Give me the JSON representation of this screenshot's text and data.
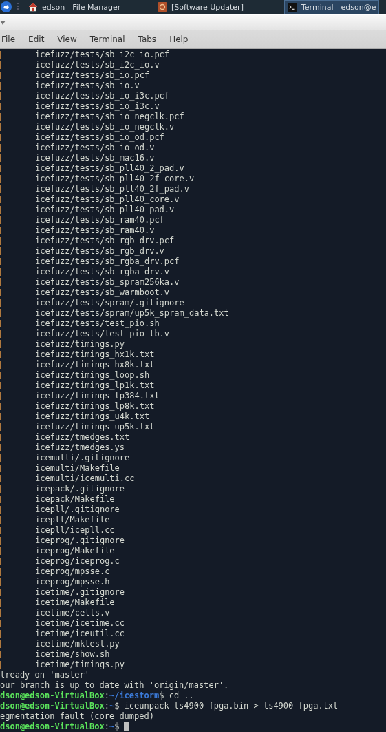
{
  "taskbar": {
    "items": [
      {
        "kind": "home",
        "label": "edson - File Manager",
        "selected": false
      },
      {
        "kind": "updater",
        "label": "[Software Updater]",
        "selected": false
      },
      {
        "kind": "terminal",
        "label": "Terminal - edson@e",
        "selected": true
      }
    ]
  },
  "menu": [
    "File",
    "Edit",
    "View",
    "Terminal",
    "Tabs",
    "Help"
  ],
  "terminal": {
    "lines": [
      {
        "kind": "file",
        "text": "icefuzz/tests/sb_i2c_io.pcf"
      },
      {
        "kind": "file",
        "text": "icefuzz/tests/sb_i2c_io.v"
      },
      {
        "kind": "file",
        "text": "icefuzz/tests/sb_io.pcf"
      },
      {
        "kind": "file",
        "text": "icefuzz/tests/sb_io.v"
      },
      {
        "kind": "file",
        "text": "icefuzz/tests/sb_io_i3c.pcf"
      },
      {
        "kind": "file",
        "text": "icefuzz/tests/sb_io_i3c.v"
      },
      {
        "kind": "file",
        "text": "icefuzz/tests/sb_io_negclk.pcf"
      },
      {
        "kind": "file",
        "text": "icefuzz/tests/sb_io_negclk.v"
      },
      {
        "kind": "file",
        "text": "icefuzz/tests/sb_io_od.pcf"
      },
      {
        "kind": "file",
        "text": "icefuzz/tests/sb_io_od.v"
      },
      {
        "kind": "file",
        "text": "icefuzz/tests/sb_mac16.v"
      },
      {
        "kind": "file",
        "text": "icefuzz/tests/sb_pll40_2_pad.v"
      },
      {
        "kind": "file",
        "text": "icefuzz/tests/sb_pll40_2f_core.v"
      },
      {
        "kind": "file",
        "text": "icefuzz/tests/sb_pll40_2f_pad.v"
      },
      {
        "kind": "file",
        "text": "icefuzz/tests/sb_pll40_core.v"
      },
      {
        "kind": "file",
        "text": "icefuzz/tests/sb_pll40_pad.v"
      },
      {
        "kind": "file",
        "text": "icefuzz/tests/sb_ram40.pcf"
      },
      {
        "kind": "file",
        "text": "icefuzz/tests/sb_ram40.v"
      },
      {
        "kind": "file",
        "text": "icefuzz/tests/sb_rgb_drv.pcf"
      },
      {
        "kind": "file",
        "text": "icefuzz/tests/sb_rgb_drv.v"
      },
      {
        "kind": "file",
        "text": "icefuzz/tests/sb_rgba_drv.pcf"
      },
      {
        "kind": "file",
        "text": "icefuzz/tests/sb_rgba_drv.v"
      },
      {
        "kind": "file",
        "text": "icefuzz/tests/sb_spram256ka.v"
      },
      {
        "kind": "file",
        "text": "icefuzz/tests/sb_warmboot.v"
      },
      {
        "kind": "file",
        "text": "icefuzz/tests/spram/.gitignore"
      },
      {
        "kind": "file",
        "text": "icefuzz/tests/spram/up5k_spram_data.txt"
      },
      {
        "kind": "file",
        "text": "icefuzz/tests/test_pio.sh"
      },
      {
        "kind": "file",
        "text": "icefuzz/tests/test_pio_tb.v"
      },
      {
        "kind": "file",
        "text": "icefuzz/timings.py"
      },
      {
        "kind": "file",
        "text": "icefuzz/timings_hx1k.txt"
      },
      {
        "kind": "file",
        "text": "icefuzz/timings_hx8k.txt"
      },
      {
        "kind": "file",
        "text": "icefuzz/timings_loop.sh"
      },
      {
        "kind": "file",
        "text": "icefuzz/timings_lp1k.txt"
      },
      {
        "kind": "file",
        "text": "icefuzz/timings_lp384.txt"
      },
      {
        "kind": "file",
        "text": "icefuzz/timings_lp8k.txt"
      },
      {
        "kind": "file",
        "text": "icefuzz/timings_u4k.txt"
      },
      {
        "kind": "file",
        "text": "icefuzz/timings_up5k.txt"
      },
      {
        "kind": "file",
        "text": "icefuzz/tmedges.txt"
      },
      {
        "kind": "file",
        "text": "icefuzz/tmedges.ys"
      },
      {
        "kind": "file",
        "text": "icemulti/.gitignore"
      },
      {
        "kind": "file",
        "text": "icemulti/Makefile"
      },
      {
        "kind": "file",
        "text": "icemulti/icemulti.cc"
      },
      {
        "kind": "file",
        "text": "icepack/.gitignore"
      },
      {
        "kind": "file",
        "text": "icepack/Makefile"
      },
      {
        "kind": "file",
        "text": "icepll/.gitignore"
      },
      {
        "kind": "file",
        "text": "icepll/Makefile"
      },
      {
        "kind": "file",
        "text": "icepll/icepll.cc"
      },
      {
        "kind": "file",
        "text": "iceprog/.gitignore"
      },
      {
        "kind": "file",
        "text": "iceprog/Makefile"
      },
      {
        "kind": "file",
        "text": "iceprog/iceprog.c"
      },
      {
        "kind": "file",
        "text": "iceprog/mpsse.c"
      },
      {
        "kind": "file",
        "text": "iceprog/mpsse.h"
      },
      {
        "kind": "file",
        "text": "icetime/.gitignore"
      },
      {
        "kind": "file",
        "text": "icetime/Makefile"
      },
      {
        "kind": "file",
        "text": "icetime/cells.v"
      },
      {
        "kind": "file",
        "text": "icetime/icetime.cc"
      },
      {
        "kind": "file",
        "text": "icetime/iceutil.cc"
      },
      {
        "kind": "file",
        "text": "icetime/mktest.py"
      },
      {
        "kind": "file",
        "text": "icetime/show.sh"
      },
      {
        "kind": "file",
        "text": "icetime/timings.py"
      },
      {
        "kind": "output",
        "text": "lready on 'master'"
      },
      {
        "kind": "output",
        "text": "our branch is up to date with 'origin/master'."
      },
      {
        "kind": "prompt",
        "user": "dson@edson-VirtualBox",
        "sep": ":",
        "path": "~/icestorm",
        "command": "$ cd .."
      },
      {
        "kind": "prompt",
        "user": "dson@edson-VirtualBox",
        "sep": ":",
        "path": "~",
        "command": "$ iceunpack ts4900-fpga.bin > ts4900-fpga.txt"
      },
      {
        "kind": "output",
        "text": "egmentation fault (core dumped)"
      },
      {
        "kind": "prompt",
        "user": "dson@edson-VirtualBox",
        "sep": ":",
        "path": "~",
        "command": "$",
        "cursor": true
      }
    ]
  }
}
